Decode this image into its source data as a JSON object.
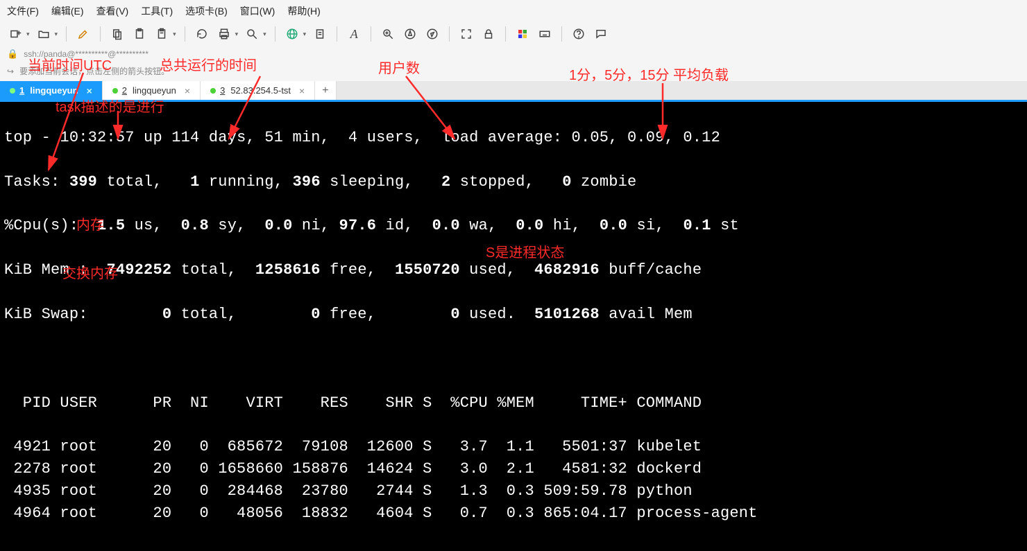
{
  "menu": {
    "file": "文件(F)",
    "edit": "编辑(E)",
    "view": "查看(V)",
    "tools": "工具(T)",
    "tabs": "选项卡(B)",
    "window": "窗口(W)",
    "help": "帮助(H)"
  },
  "toolbar_icons": [
    "new-tab-icon",
    "open-icon",
    "edit-icon",
    "copy-icon",
    "paste-icon",
    "refresh-icon",
    "print-icon",
    "search-icon",
    "globe-icon",
    "clipboard-icon",
    "font-icon",
    "zoom-in-icon",
    "compass-icon",
    "fullscreen-icon",
    "lock-icon",
    "color-icon",
    "keyboard-icon",
    "help-icon",
    "chat-icon"
  ],
  "addrbar": {
    "text": "ssh://panda@**********@**********"
  },
  "hintbar": {
    "text": "要添加当前会话，点击左侧的箭头按钮。"
  },
  "tabs": [
    {
      "num": "1",
      "label": "lingqueyun",
      "active": true,
      "dot": true
    },
    {
      "num": "2",
      "label": "lingqueyun",
      "active": false,
      "dot": true
    },
    {
      "num": "3",
      "label": "52.83.254.5-tst",
      "active": false,
      "dot": true
    }
  ],
  "top": {
    "line1_prefix": "top - ",
    "time": "10:32:57",
    "uptime": " up 114 days, 51 min,  ",
    "users": "4 users,",
    "load_label": "  load average: ",
    "load": "0.05, 0.09, 0.12",
    "tasks_label": "Tasks: ",
    "tasks_total": "399",
    "tasks_total_lbl": " total,   ",
    "tasks_running": "1",
    "tasks_running_lbl": " running, ",
    "tasks_sleeping": "396",
    "tasks_sleeping_lbl": " sleeping,   ",
    "tasks_stopped": "2",
    "tasks_stopped_lbl": " stopped,   ",
    "tasks_zombie": "0",
    "tasks_zombie_lbl": " zombie",
    "cpu_label": "%Cpu(s):  ",
    "cpu_us": "1.5",
    "cpu_sy": "0.8",
    "cpu_ni": "0.0",
    "cpu_id": "97.6",
    "cpu_wa": "0.0",
    "cpu_hi": "0.0",
    "cpu_si": "0.0",
    "cpu_st": "0.1",
    "mem_label": "KiB Mem :  ",
    "mem_total": "7492252",
    "mem_free": "1258616",
    "mem_used": "1550720",
    "mem_buff": "4682916",
    "swap_label": "KiB Swap:        ",
    "swap_total": "0",
    "swap_free": "0",
    "swap_used": "0",
    "swap_avail": "5101268"
  },
  "proc_header": "  PID USER      PR  NI    VIRT    RES    SHR S  %CPU %MEM     TIME+ COMMAND",
  "processes": [
    {
      "pid": " 4921",
      "user": "root",
      "pr": "20",
      "ni": "0",
      "virt": "685672",
      "res": "79108",
      "shr": "12600",
      "s": "S",
      "cpu": "3.7",
      "mem": "1.1",
      "time": "5501:37",
      "cmd": "kubelet"
    },
    {
      "pid": " 2278",
      "user": "root",
      "pr": "20",
      "ni": "0",
      "virt": "1658660",
      "res": "158876",
      "shr": "14624",
      "s": "S",
      "cpu": "3.0",
      "mem": "2.1",
      "time": "4581:32",
      "cmd": "dockerd"
    },
    {
      "pid": " 4935",
      "user": "root",
      "pr": "20",
      "ni": "0",
      "virt": "284468",
      "res": "23780",
      "shr": "2744",
      "s": "S",
      "cpu": "1.3",
      "mem": "0.3",
      "time": "509:59.78",
      "cmd": "python"
    },
    {
      "pid": " 4964",
      "user": "root",
      "pr": "20",
      "ni": "0",
      "virt": "48056",
      "res": "18832",
      "shr": "4604",
      "s": "S",
      "cpu": "0.7",
      "mem": "0.3",
      "time": "865:04.17",
      "cmd": "process-agent"
    }
  ],
  "annotations": {
    "utc_time": "当前时间UTC",
    "uptime": "总共运行的时间",
    "users": "用户数",
    "loadavg": "1分，5分，15分 平均负载",
    "task_desc": "task描述的是进行",
    "mem": "内存",
    "swap": "交换内存",
    "s_col": "S是进程状态"
  }
}
